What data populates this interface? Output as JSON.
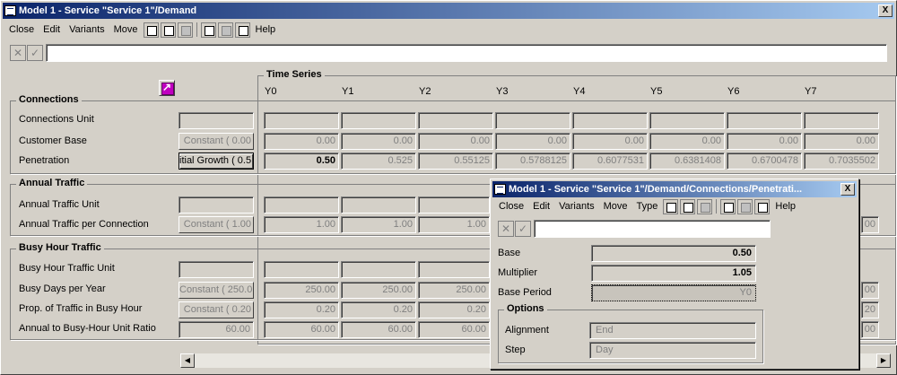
{
  "window": {
    "title": "Model 1 - Service \"Service 1\"/Demand",
    "close_symbol": "X"
  },
  "menu": [
    "Close",
    "Edit",
    "Variants",
    "Move"
  ],
  "help_label": "Help",
  "editor": {
    "cancel_symbol": "✕",
    "ok_symbol": "✓"
  },
  "time_series": {
    "title": "Time Series",
    "years": [
      "Y0",
      "Y1",
      "Y2",
      "Y3",
      "Y4",
      "Y5",
      "Y6",
      "Y7"
    ]
  },
  "groups": {
    "connections": "Connections",
    "annual_traffic": "Annual Traffic",
    "busy_hour": "Busy Hour Traffic"
  },
  "rows": {
    "connections_unit": {
      "label": "Connections Unit"
    },
    "customer_base": {
      "label": "Customer Base",
      "formula": "Constant ( 0.00",
      "values": [
        "0.00",
        "0.00",
        "0.00",
        "0.00",
        "0.00",
        "0.00",
        "0.00",
        "0.00"
      ]
    },
    "penetration": {
      "label": "Penetration",
      "formula": "itial Growth ( 0.5",
      "values": [
        "0.50",
        "0.525",
        "0.55125",
        "0.5788125",
        "0.6077531",
        "0.6381408",
        "0.6700478",
        "0.7035502"
      ]
    },
    "annual_traffic_unit": {
      "label": "Annual Traffic Unit"
    },
    "annual_traffic_per_connection": {
      "label": "Annual Traffic per Connection",
      "formula": "Constant ( 1.00",
      "values": [
        "1.00",
        "1.00",
        "1.00"
      ]
    },
    "busy_hour_traffic_unit": {
      "label": "Busy Hour Traffic Unit"
    },
    "busy_days_per_year": {
      "label": "Busy Days per Year",
      "formula": "Constant ( 250.0",
      "values": [
        "250.00",
        "250.00",
        "250.00"
      ]
    },
    "prop_traffic_busy_hour": {
      "label": "Prop. of Traffic in Busy Hour",
      "formula": "Constant ( 0.20",
      "values": [
        "0.20",
        "0.20",
        "0.20"
      ],
      "right_value": "20"
    },
    "annual_to_busy_ratio": {
      "label": "Annual to Busy-Hour Unit Ratio",
      "value": "60.00",
      "values": [
        "60.00",
        "60.00",
        "60.00"
      ],
      "right_value": "00"
    }
  },
  "right_values": {
    "annual_traffic_per_connection": "00",
    "busy_days_per_year": "00"
  },
  "popup": {
    "title": "Model 1 - Service \"Service 1\"/Demand/Connections/Penetrati...",
    "close_symbol": "X",
    "menu": [
      "Close",
      "Edit",
      "Variants",
      "Move",
      "Type"
    ],
    "help_label": "Help",
    "base_label": "Base",
    "base_value": "0.50",
    "multiplier_label": "Multiplier",
    "multiplier_value": "1.05",
    "base_period_label": "Base Period",
    "base_period_value": "Y0",
    "options_title": "Options",
    "alignment_label": "Alignment",
    "alignment_value": "End",
    "step_label": "Step",
    "step_value": "Day"
  },
  "scroll": {
    "left": "◀",
    "right": "▶"
  }
}
